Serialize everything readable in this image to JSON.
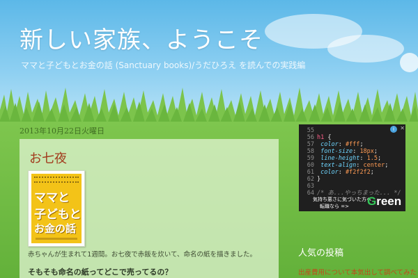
{
  "header": {
    "blog_title": "新しい家族、ようこそ",
    "blog_description": "ママと子どもとお金の話 (Sanctuary books)/うだひろえ を読んでの実践編"
  },
  "post": {
    "date": "2013年10月22日火曜日",
    "title": "お七夜",
    "book_words": [
      "ママと",
      "子どもと",
      "お金の話"
    ],
    "body_text": "赤ちゃんが生まれて1週間。お七夜で赤飯を炊いて、命名の紙を描きました。",
    "subheading": "そもそも命名の紙ってどこで売ってるの？"
  },
  "ad": {
    "info_icon": "info-icon",
    "close_icon": "close-icon",
    "code_lines": [
      {
        "n": "55",
        "parts": [
          [
            "plain",
            ""
          ]
        ]
      },
      {
        "n": "56",
        "parts": [
          [
            "sel",
            "h1"
          ],
          [
            "plain",
            " {"
          ]
        ]
      },
      {
        "n": "57",
        "parts": [
          [
            "prop",
            "  color"
          ],
          [
            "plain",
            ": "
          ],
          [
            "num",
            "#fff"
          ],
          [
            "plain",
            ";"
          ]
        ]
      },
      {
        "n": "58",
        "parts": [
          [
            "prop",
            "  font-size"
          ],
          [
            "plain",
            ": "
          ],
          [
            "num",
            "18px"
          ],
          [
            "plain",
            ";"
          ]
        ]
      },
      {
        "n": "59",
        "parts": [
          [
            "prop",
            "  line-height"
          ],
          [
            "plain",
            ": "
          ],
          [
            "num",
            "1.5"
          ],
          [
            "plain",
            ";"
          ]
        ]
      },
      {
        "n": "60",
        "parts": [
          [
            "prop",
            "  text-align"
          ],
          [
            "plain",
            ": "
          ],
          [
            "num",
            "center"
          ],
          [
            "plain",
            ";"
          ]
        ]
      },
      {
        "n": "61",
        "parts": [
          [
            "prop",
            "  color"
          ],
          [
            "plain",
            ": "
          ],
          [
            "num",
            "#f2f2f2"
          ],
          [
            "plain",
            ";"
          ]
        ]
      },
      {
        "n": "62",
        "parts": [
          [
            "plain",
            "}"
          ]
        ]
      },
      {
        "n": "63",
        "parts": [
          [
            "plain",
            ""
          ]
        ]
      },
      {
        "n": "64",
        "parts": [
          [
            "cmt",
            "/* あ...やっちまった... */"
          ]
        ]
      }
    ],
    "cta_line1": "気持ち悪さに気づいた方へ",
    "cta_line2": "転職なら =>",
    "brand_initial": "G",
    "brand_rest": "reen"
  },
  "sidebar": {
    "popular_title": "人気の投稿",
    "popular_items": [
      "出産費用について本気出して調べてみた"
    ]
  },
  "colors": {
    "sky": "#5cb8e8",
    "grass": "#6cb93f",
    "post_title": "#a23a1c",
    "link": "#c14a1c",
    "ad_bg": "#1f1f1f"
  }
}
